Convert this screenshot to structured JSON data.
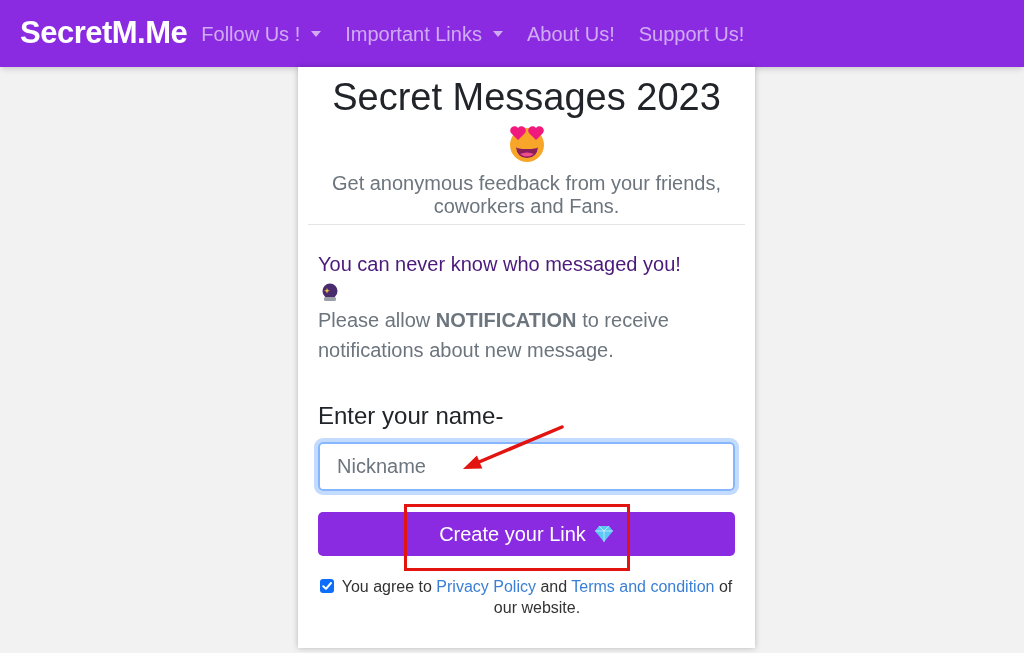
{
  "navbar": {
    "brand": "SecretM.Me",
    "links": [
      {
        "label": "Follow Us !",
        "dropdown": true
      },
      {
        "label": "Important Links",
        "dropdown": true
      },
      {
        "label": "About Us!",
        "dropdown": false
      },
      {
        "label": "Support Us!",
        "dropdown": false
      }
    ]
  },
  "card": {
    "title": "Secret Messages 2023",
    "subtitle": "Get anonymous feedback from your friends, coworkers and Fans.",
    "tagline": "You can never know who messaged you!",
    "notice": "Please allow **NOTIFICATION** to receive notifications about new message.",
    "name_label": "Enter your name-",
    "name_field": {
      "placeholder": "Nickname",
      "focused": true
    },
    "create_button": "Create your Link",
    "agreement": {
      "checked": true,
      "parts": [
        {
          "kind": "text",
          "text": "You agree to"
        },
        {
          "kind": "link",
          "text": "Privacy Policy"
        },
        {
          "kind": "text",
          "text": "and"
        },
        {
          "kind": "link",
          "text": "Terms and condition"
        },
        {
          "kind": "text",
          "text": "of our website."
        }
      ]
    }
  },
  "annotations": [
    {
      "kind": "arrow"
    },
    {
      "kind": "rectangle"
    }
  ]
}
